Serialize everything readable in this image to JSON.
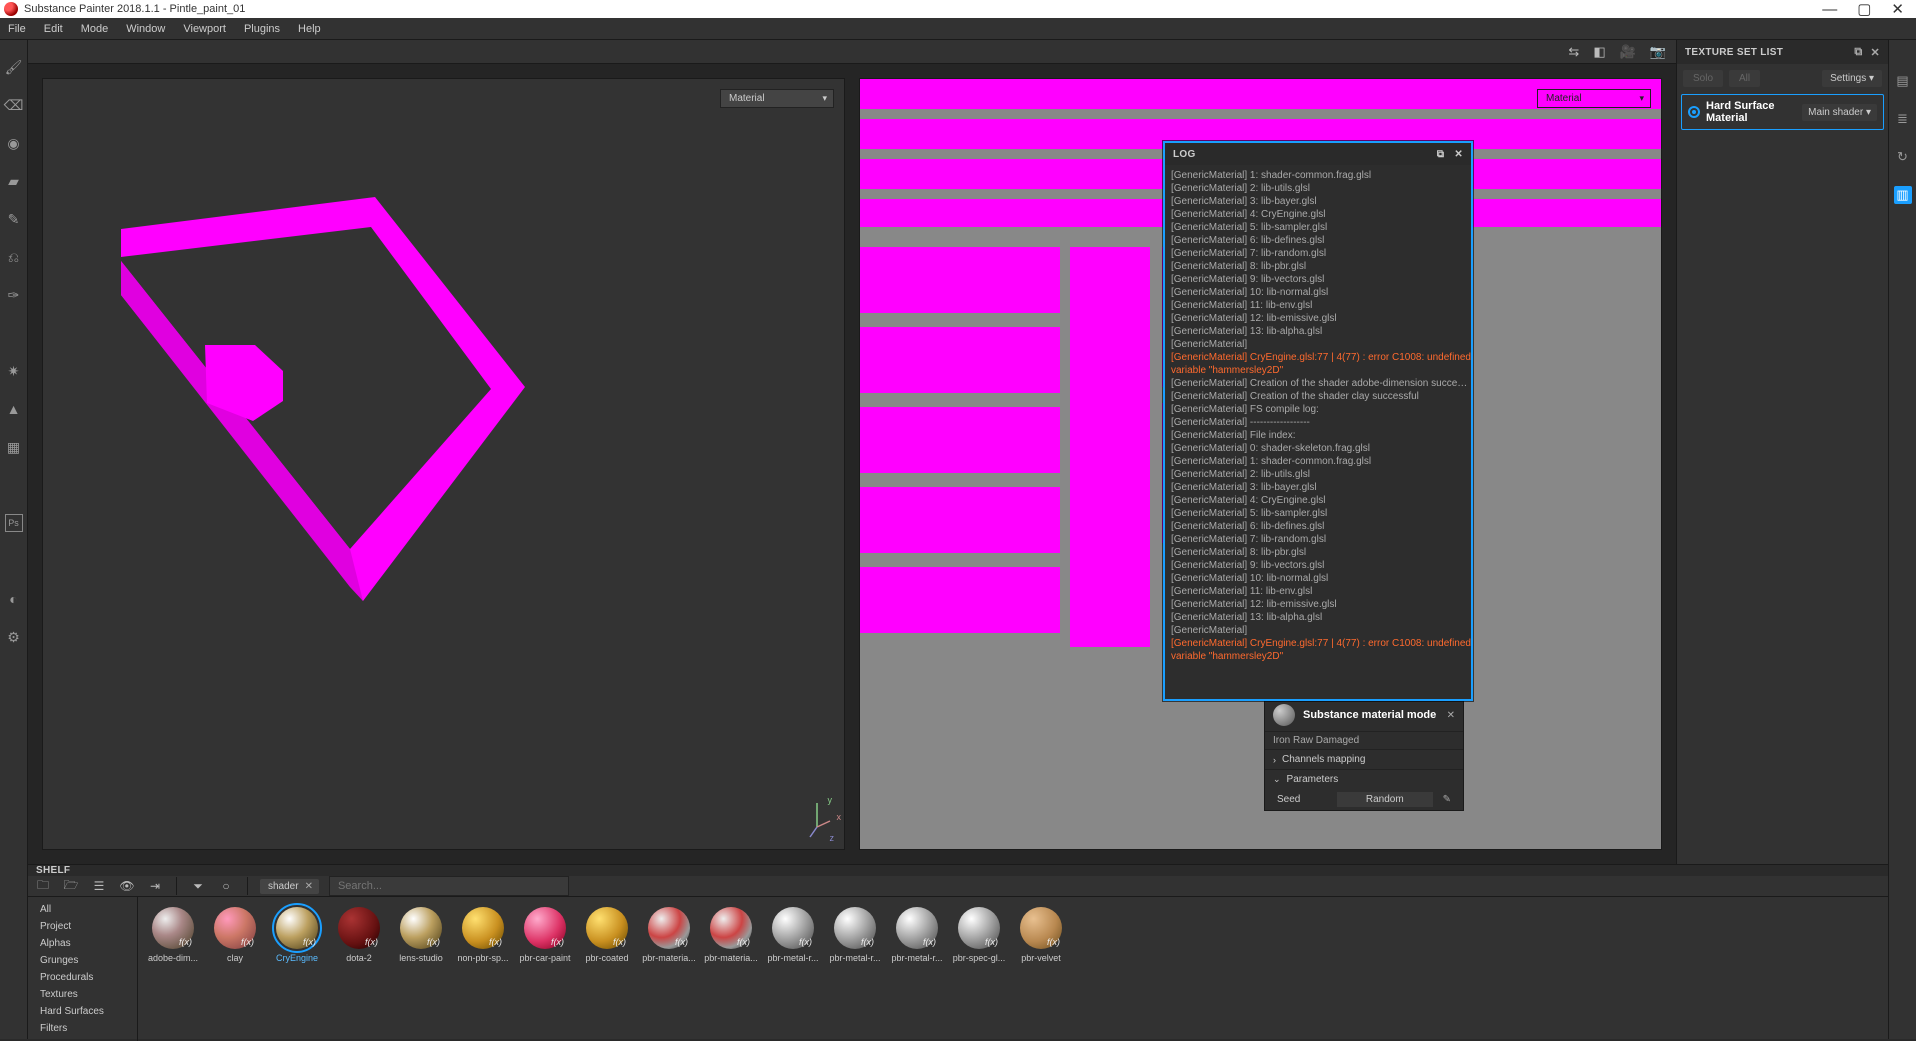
{
  "title": "Substance Painter 2018.1.1 - Pintle_paint_01",
  "window_controls": {
    "min": "—",
    "max": "▢",
    "close": "✕"
  },
  "menu": [
    "File",
    "Edit",
    "Mode",
    "Window",
    "Viewport",
    "Plugins",
    "Help"
  ],
  "viewport_dropdown": "Material",
  "axis": {
    "x": "x",
    "y": "y",
    "z": "z"
  },
  "texture_set_panel": {
    "title": "TEXTURE SET LIST",
    "tabs": {
      "solo": "Solo",
      "all": "All"
    },
    "settings_label": "Settings ▾",
    "material_name": "Hard Surface Material",
    "shader_label": "Main shader ▾"
  },
  "log_panel": {
    "title": "LOG",
    "lines": [
      {
        "t": "[GenericMaterial] 1: shader-common.frag.glsl"
      },
      {
        "t": "[GenericMaterial] 2: lib-utils.glsl"
      },
      {
        "t": "[GenericMaterial] 3: lib-bayer.glsl"
      },
      {
        "t": "[GenericMaterial] 4: CryEngine.glsl"
      },
      {
        "t": "[GenericMaterial] 5: lib-sampler.glsl"
      },
      {
        "t": "[GenericMaterial] 6: lib-defines.glsl"
      },
      {
        "t": "[GenericMaterial] 7: lib-random.glsl"
      },
      {
        "t": "[GenericMaterial] 8: lib-pbr.glsl"
      },
      {
        "t": "[GenericMaterial] 9: lib-vectors.glsl"
      },
      {
        "t": "[GenericMaterial] 10: lib-normal.glsl"
      },
      {
        "t": "[GenericMaterial] 11: lib-env.glsl"
      },
      {
        "t": "[GenericMaterial] 12: lib-emissive.glsl"
      },
      {
        "t": "[GenericMaterial] 13: lib-alpha.glsl"
      },
      {
        "t": "[GenericMaterial]"
      },
      {
        "t": "[GenericMaterial] CryEngine.glsl:77 | 4(77) : error C1008: undefined variable \"hammersley2D\"",
        "err": true
      },
      {
        "t": "[GenericMaterial] Creation of the shader adobe-dimension successful"
      },
      {
        "t": "[GenericMaterial] Creation of the shader clay successful"
      },
      {
        "t": "[GenericMaterial] FS compile log:"
      },
      {
        "t": "[GenericMaterial] ------------------"
      },
      {
        "t": "[GenericMaterial] File index:"
      },
      {
        "t": "[GenericMaterial] 0: shader-skeleton.frag.glsl"
      },
      {
        "t": "[GenericMaterial] 1: shader-common.frag.glsl"
      },
      {
        "t": "[GenericMaterial] 2: lib-utils.glsl"
      },
      {
        "t": "[GenericMaterial] 3: lib-bayer.glsl"
      },
      {
        "t": "[GenericMaterial] 4: CryEngine.glsl"
      },
      {
        "t": "[GenericMaterial] 5: lib-sampler.glsl"
      },
      {
        "t": "[GenericMaterial] 6: lib-defines.glsl"
      },
      {
        "t": "[GenericMaterial] 7: lib-random.glsl"
      },
      {
        "t": "[GenericMaterial] 8: lib-pbr.glsl"
      },
      {
        "t": "[GenericMaterial] 9: lib-vectors.glsl"
      },
      {
        "t": "[GenericMaterial] 10: lib-normal.glsl"
      },
      {
        "t": "[GenericMaterial] 11: lib-env.glsl"
      },
      {
        "t": "[GenericMaterial] 12: lib-emissive.glsl"
      },
      {
        "t": "[GenericMaterial] 13: lib-alpha.glsl"
      },
      {
        "t": "[GenericMaterial]"
      },
      {
        "t": "[GenericMaterial] CryEngine.glsl:77 | 4(77) : error C1008: undefined variable \"hammersley2D\"",
        "err": true
      }
    ]
  },
  "shelf": {
    "title": "SHELF",
    "filter_chip": "shader",
    "search_placeholder": "Search...",
    "categories": [
      "All",
      "Project",
      "Alphas",
      "Grunges",
      "Procedurals",
      "Textures",
      "Hard Surfaces",
      "Filters"
    ],
    "items": [
      {
        "label": "adobe-dim...",
        "bg": "radial-gradient(circle at 32% 28%,#eee,#a88 40%,#654 80%)"
      },
      {
        "label": "clay",
        "bg": "radial-gradient(circle at 32% 28%,#f9b,#c76 45%,#844 90%)"
      },
      {
        "label": "CryEngine",
        "sel": true,
        "bg": "radial-gradient(circle at 32% 28%,#fff,#bca060 45%,#5a4a20 90%)"
      },
      {
        "label": "dota-2",
        "bg": "radial-gradient(circle at 32% 28%,#a33,#611 60%,#200 95%)"
      },
      {
        "label": "lens-studio",
        "bg": "radial-gradient(circle at 32% 28%,#fff,#bca060 45%,#5a4a20 90%)"
      },
      {
        "label": "non-pbr-sp...",
        "bg": "radial-gradient(circle at 32% 28%,#ffe070,#c99020 55%,#6a4a00 95%)"
      },
      {
        "label": "pbr-car-paint",
        "bg": "radial-gradient(circle at 32% 28%,#fac,#d36 55%,#802 95%)"
      },
      {
        "label": "pbr-coated",
        "bg": "radial-gradient(circle at 32% 28%,#ffe070,#c99020 55%,#6a4a00 95%)"
      },
      {
        "label": "pbr-materia...",
        "bg": "radial-gradient(circle at 32% 28%,#eee,#c44 45%,#999 70%,#333 95%)"
      },
      {
        "label": "pbr-materia...",
        "bg": "radial-gradient(circle at 32% 28%,#eee,#c44 45%,#999 70%,#333 95%)"
      },
      {
        "label": "pbr-metal-r...",
        "bg": "radial-gradient(circle at 32% 28%,#fff,#aaa 45%,#555 90%)"
      },
      {
        "label": "pbr-metal-r...",
        "bg": "radial-gradient(circle at 32% 28%,#fff,#aaa 45%,#555 90%)"
      },
      {
        "label": "pbr-metal-r...",
        "bg": "radial-gradient(circle at 32% 28%,#fff,#aaa 45%,#555 90%)"
      },
      {
        "label": "pbr-spec-gl...",
        "bg": "radial-gradient(circle at 32% 28%,#fff,#aaa 45%,#555 90%)"
      },
      {
        "label": "pbr-velvet",
        "bg": "radial-gradient(circle at 32% 28%,#e8c090,#b88850 55%,#705020 95%)"
      }
    ]
  },
  "props": {
    "title": "Substance material mode",
    "subtitle": "Iron Raw Damaged",
    "channels": "Channels mapping",
    "parameters": "Parameters",
    "seed_label": "Seed",
    "seed_value": "Random"
  }
}
